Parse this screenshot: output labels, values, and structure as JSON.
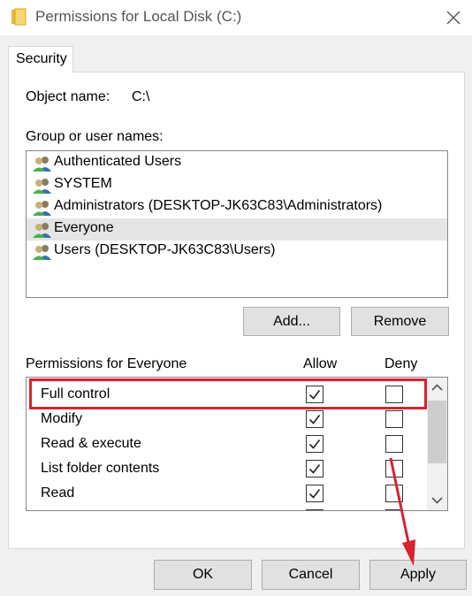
{
  "window": {
    "title": "Permissions for Local Disk (C:)",
    "icons": {
      "folder": "folder-icon",
      "close": "close-icon"
    }
  },
  "tabs": [
    {
      "label": "Security"
    }
  ],
  "object": {
    "label": "Object name:",
    "value": "C:\\"
  },
  "group": {
    "label": "Group or user names:",
    "users": [
      {
        "name": "Authenticated Users",
        "selected": false
      },
      {
        "name": "SYSTEM",
        "selected": false
      },
      {
        "name": "Administrators (DESKTOP-JK63C83\\Administrators)",
        "selected": false
      },
      {
        "name": "Everyone",
        "selected": true
      },
      {
        "name": "Users (DESKTOP-JK63C83\\Users)",
        "selected": false
      }
    ],
    "add_label": "Add...",
    "remove_label": "Remove"
  },
  "permissions": {
    "label": "Permissions for Everyone",
    "allow_header": "Allow",
    "deny_header": "Deny",
    "rows": [
      {
        "name": "Full control",
        "allow": true,
        "deny": false
      },
      {
        "name": "Modify",
        "allow": true,
        "deny": false
      },
      {
        "name": "Read & execute",
        "allow": true,
        "deny": false
      },
      {
        "name": "List folder contents",
        "allow": true,
        "deny": false
      },
      {
        "name": "Read",
        "allow": true,
        "deny": false
      }
    ]
  },
  "footer": {
    "ok_label": "OK",
    "cancel_label": "Cancel",
    "apply_label": "Apply"
  },
  "colors": {
    "annotation": "#d6232e",
    "selection": "#e5e5e5"
  }
}
